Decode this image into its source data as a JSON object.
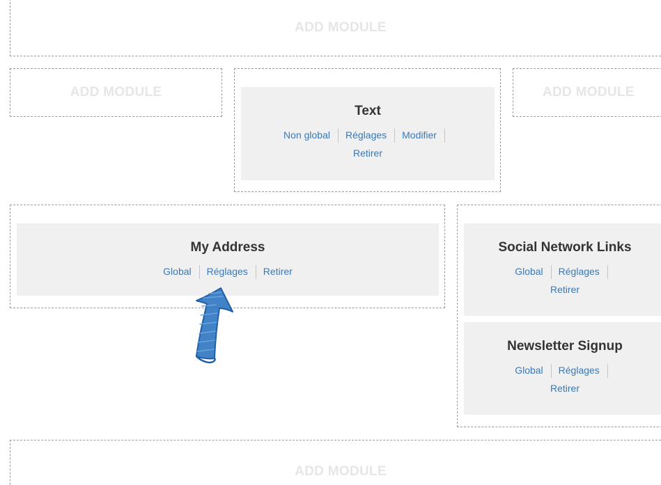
{
  "slots": {
    "top": {
      "label": "ADD MODULE"
    },
    "row2_left": {
      "label": "ADD MODULE"
    },
    "row2_right": {
      "label": "ADD MODULE"
    },
    "bottom": {
      "label": "ADD MODULE"
    }
  },
  "modules": {
    "text": {
      "title": "Text",
      "actions": [
        "Non global",
        "Réglages",
        "Modifier",
        "Retirer"
      ]
    },
    "my_address": {
      "title": "My Address",
      "actions": [
        "Global",
        "Réglages",
        "Retirer"
      ]
    },
    "social": {
      "title": "Social Network Links",
      "actions": [
        "Global",
        "Réglages",
        "Retirer"
      ]
    },
    "newsletter": {
      "title": "Newsletter Signup",
      "actions": [
        "Global",
        "Réglages",
        "Retirer"
      ]
    }
  },
  "annotation": {
    "icon": "hand-drawn-arrow-icon",
    "color": "#2e74c0"
  },
  "colors": {
    "link": "#3a78b4",
    "module_bg": "#f0f0f0",
    "title": "#333333",
    "placeholder_text": "#e6e6e6",
    "dashed_border": "#9a9a9a"
  }
}
